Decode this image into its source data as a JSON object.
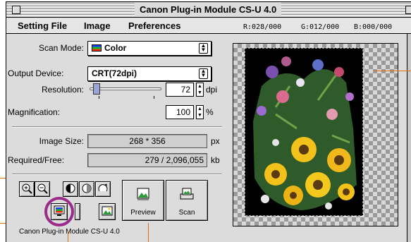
{
  "window": {
    "title": "Canon Plug-in Module CS-U 4.0"
  },
  "menubar": {
    "items": [
      "Setting File",
      "Image",
      "Preferences"
    ],
    "rgb": {
      "r": "R:028/000",
      "g": "G:012/000",
      "b": "B:000/000"
    }
  },
  "scan_mode": {
    "label": "Scan Mode:",
    "value": "Color"
  },
  "output_device": {
    "label": "Output Device:",
    "value": "CRT(72dpi)"
  },
  "resolution": {
    "label": "Resolution:",
    "value": "72",
    "unit": "dpi",
    "slider_fraction": 0.05
  },
  "magnification": {
    "label": "Magnification:",
    "value": "100",
    "unit": "%"
  },
  "image_size": {
    "label": "Image Size:",
    "value": "268 * 356",
    "unit": "px"
  },
  "required_free": {
    "label": "Required/Free:",
    "value": "279 / 2,096,055",
    "unit": "kb"
  },
  "buttons": {
    "preview_label": "Preview",
    "scan_label": "Scan"
  },
  "footer": {
    "text": "Canon Plug-in Module CS-U 4.0"
  },
  "colors": {
    "callout": "#e06e10",
    "highlight_ring": "#9b2a8c",
    "preview_bg": "#000000"
  }
}
